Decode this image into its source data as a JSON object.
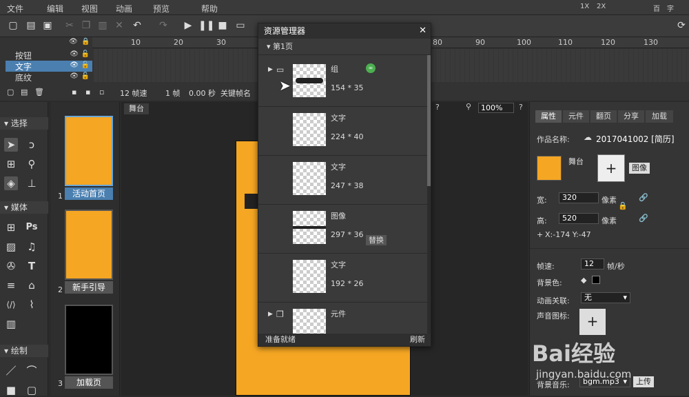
{
  "menu": {
    "items": [
      "文件",
      "编辑",
      "视图",
      "动画",
      "预览",
      "帮助"
    ],
    "right_icons": [
      "1X",
      "2X",
      "百",
      "字"
    ]
  },
  "timeline": {
    "ruler": [
      "10",
      "20",
      "30",
      "80",
      "90",
      "100",
      "110",
      "120",
      "130"
    ],
    "layers": [
      {
        "name": "按钮"
      },
      {
        "name": "文字"
      },
      {
        "name": "底纹"
      }
    ],
    "fps": "12 帧速",
    "frame": "1 帧",
    "time": "0.00 秒",
    "keyframe_label": "关键帧名"
  },
  "tools": {
    "select_section": "选择",
    "media_section": "媒体",
    "draw_section": "绘制"
  },
  "pages": [
    {
      "num": "1",
      "label": "活动首页"
    },
    {
      "num": "2",
      "label": "新手引导"
    },
    {
      "num": "3",
      "label": "加载页"
    }
  ],
  "stage": {
    "tab": "舞台",
    "zoom": "100%"
  },
  "asset_dialog": {
    "title": "资源管理器",
    "page_label": "第1页",
    "assets": [
      {
        "name": "组",
        "size": "154 * 35",
        "link_icon": "link-icon"
      },
      {
        "name": "文字",
        "size": "224 * 40"
      },
      {
        "name": "文字",
        "size": "247 * 38"
      },
      {
        "name": "图像",
        "size": "297 * 36",
        "action": "替换"
      },
      {
        "name": "文字",
        "size": "192 * 26"
      },
      {
        "name": "元件",
        "size": ""
      }
    ],
    "status": "准备就绪",
    "refresh": "刷新"
  },
  "properties": {
    "tabs": [
      "属性",
      "元件",
      "翻页",
      "分享",
      "加载"
    ],
    "work_name_label": "作品名称:",
    "work_name": "2017041002 [简历]",
    "stage_label": "舞台",
    "image_button": "图像",
    "width_label": "宽:",
    "width": "320",
    "width_unit": "像素",
    "height_label": "高:",
    "height": "520",
    "height_unit": "像素",
    "xy": "X:-174    Y:-47",
    "fps_label": "帧速:",
    "fps_value": "12",
    "fps_unit": "帧/秒",
    "bg_color_label": "背景色:",
    "anim_label": "动画关联:",
    "anim_value": "无",
    "sound_icon_label": "声音图标:",
    "bg_music_label": "背景音乐:",
    "bg_music_value": "bgm.mp3",
    "upload_button": "上传"
  },
  "watermark": {
    "text": "Bai经验",
    "url": "jingyan.baidu.com"
  },
  "colors": {
    "accent": "#4a7fb0",
    "canvas": "#f5a623",
    "panel": "#353535"
  }
}
